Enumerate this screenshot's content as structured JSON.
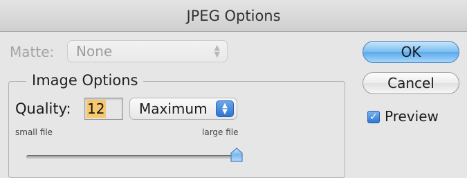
{
  "dialog": {
    "title": "JPEG Options"
  },
  "matte": {
    "label": "Matte:",
    "value": "None",
    "enabled": false
  },
  "image_options": {
    "group_label": "Image Options",
    "quality_label": "Quality:",
    "quality_value": "12",
    "quality_preset": "Maximum",
    "slider": {
      "min_label": "small file",
      "max_label": "large file",
      "min": 0,
      "max": 12,
      "value": 12
    }
  },
  "buttons": {
    "ok_label": "OK",
    "cancel_label": "Cancel"
  },
  "preview": {
    "label": "Preview",
    "checked": true
  },
  "icons": {
    "stepper": "updown-arrows-icon",
    "check": "checkmark-icon",
    "thumb": "slider-thumb-icon"
  },
  "colors": {
    "accent": "#3a82dc",
    "quality_highlight": "#f7c86e"
  }
}
